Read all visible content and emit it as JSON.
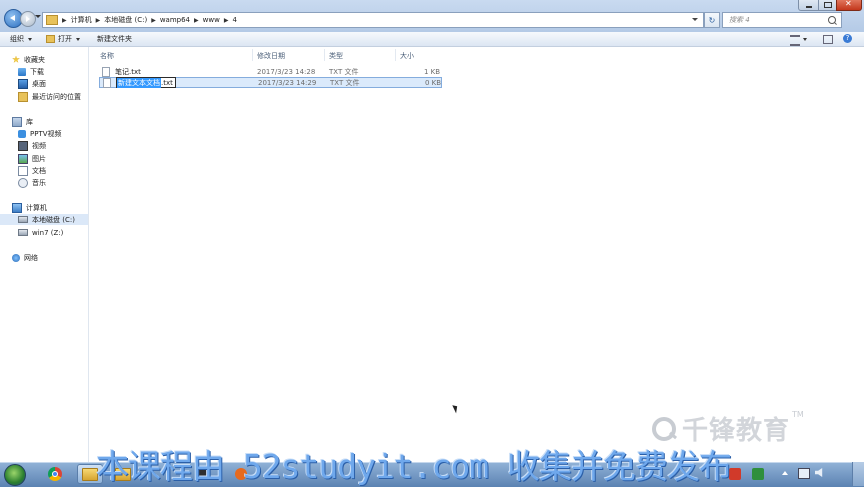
{
  "address_bar": {
    "breadcrumbs": [
      "计算机",
      "本地磁盘 (C:)",
      "wamp64",
      "www",
      "4"
    ],
    "search_placeholder": "搜索 4"
  },
  "toolbar": {
    "organize": "组织",
    "open": "打开",
    "new_folder": "新建文件夹"
  },
  "nav": {
    "favorites": "收藏夹",
    "downloads": "下载",
    "desktop": "桌面",
    "recent": "最近访问的位置",
    "libraries": "库",
    "pptv": "PPTV视频",
    "videos": "视频",
    "pictures": "图片",
    "documents": "文档",
    "music": "音乐",
    "computer": "计算机",
    "local_disk": "本地磁盘 (C:)",
    "win7_drive": "win7 (Z:)",
    "network": "网络"
  },
  "columns": {
    "name": "名称",
    "modified": "修改日期",
    "type": "类型",
    "size": "大小"
  },
  "files": [
    {
      "name": "笔记.txt",
      "modified": "2017/3/23 14:28",
      "type": "TXT 文件",
      "size": "1 KB"
    },
    {
      "name_selected": "新建文本文档",
      "name_ext": ".txt",
      "modified": "2017/3/23 14:29",
      "type": "TXT 文件",
      "size": "0 KB"
    }
  ],
  "watermark": {
    "logo_text": "千锋教育",
    "logo_tm": "TM",
    "banner": "本课程由 52studyit.com 收集并免费发布"
  },
  "colors": {
    "selection": "#3399ff",
    "banner": "#6fa8ec",
    "taskbar": "#5b82b2"
  }
}
